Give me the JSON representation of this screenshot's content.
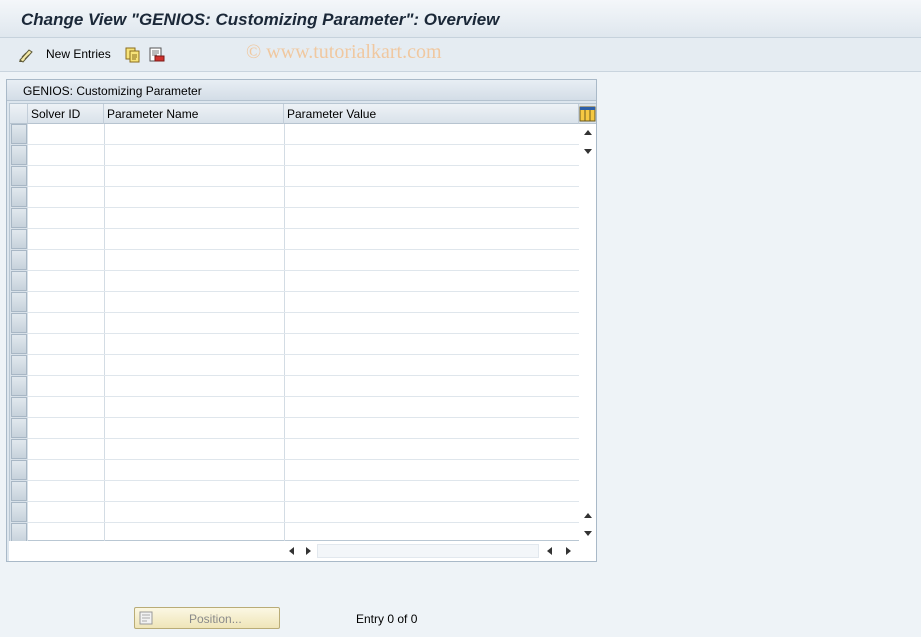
{
  "window": {
    "title": "Change View \"GENIOS: Customizing Parameter\": Overview"
  },
  "toolbar": {
    "new_entries_label": "New Entries",
    "watermark": "© www.tutorialkart.com",
    "icons": [
      "display-change-icon",
      "copy-icon",
      "delete-icon"
    ]
  },
  "table": {
    "title": "GENIOS: Customizing Parameter",
    "columns": [
      "Solver ID",
      "Parameter Name",
      "Parameter Value"
    ],
    "rows": []
  },
  "footer": {
    "position_label": "Position...",
    "entry_info": "Entry 0 of 0"
  }
}
